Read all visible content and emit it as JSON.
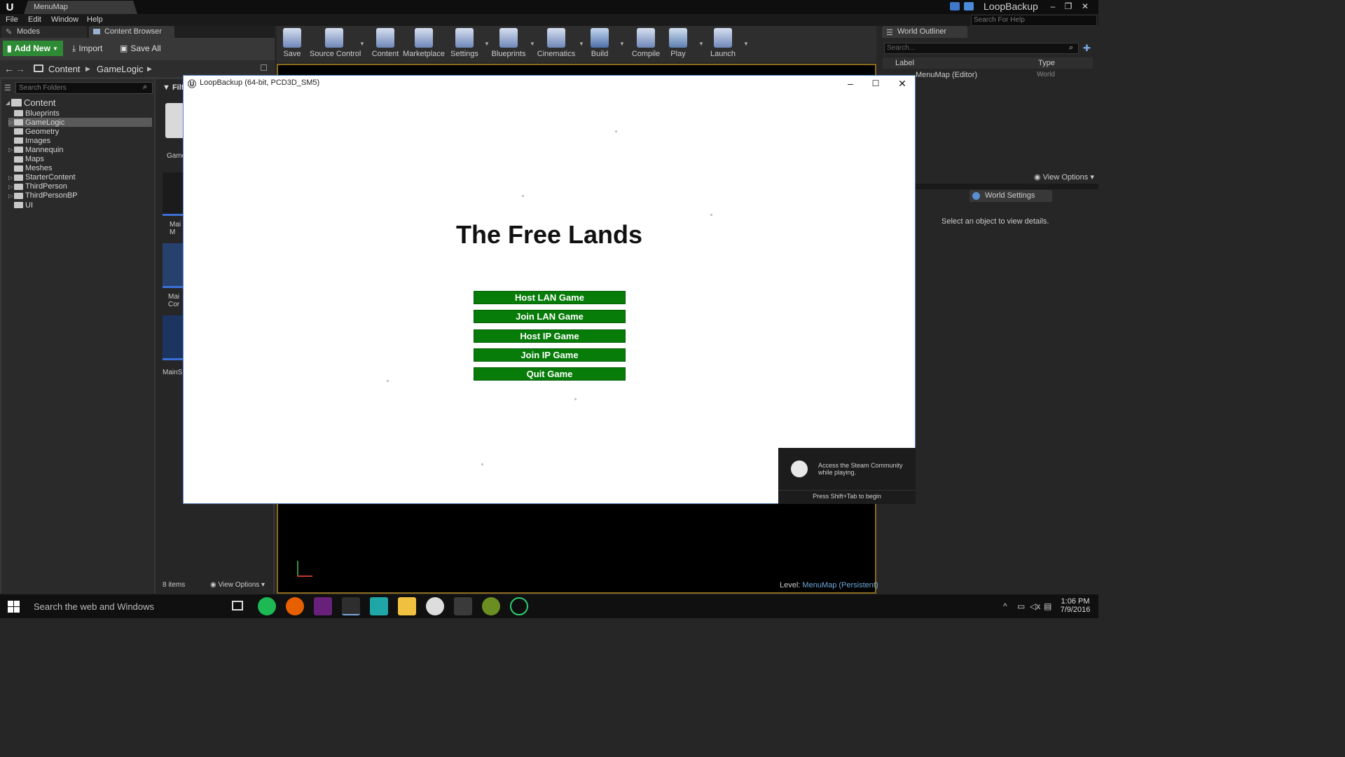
{
  "titlebar": {
    "tab_title": "MenuMap",
    "project_name": "LoopBackup"
  },
  "menubar": {
    "items": [
      "File",
      "Edit",
      "Window",
      "Help"
    ],
    "help_search_placeholder": "Search For Help"
  },
  "left_tabs": {
    "modes": "Modes",
    "content_browser": "Content Browser"
  },
  "content_browser": {
    "add_new": "Add New",
    "import": "Import",
    "save_all": "Save All",
    "path": [
      "Content",
      "GameLogic"
    ],
    "search_folders_placeholder": "Search Folders",
    "filters": "Filte",
    "root": "Content",
    "folders": [
      "Blueprints",
      "GameLogic",
      "Geometry",
      "Images",
      "Mannequin",
      "Maps",
      "Meshes",
      "StarterContent",
      "ThirdPerson",
      "ThirdPersonBP",
      "UI"
    ],
    "assets": [
      "Game",
      "Mai\nM",
      "Mai\nCor",
      "MainS"
    ],
    "item_count": "8 items",
    "view_options": "View Options"
  },
  "toolbar": {
    "buttons": [
      "Save",
      "Source Control",
      "Content",
      "Marketplace",
      "Settings",
      "Blueprints",
      "Cinematics",
      "Build",
      "Compile",
      "Play",
      "Launch"
    ]
  },
  "viewport": {
    "level_label": "Level:",
    "level_name": "MenuMap (Persistent)"
  },
  "game_window": {
    "title": "LoopBackup (64-bit, PCD3D_SM5)",
    "heading": "The Free Lands",
    "buttons": [
      "Host LAN Game",
      "Join LAN Game",
      "Host IP Game",
      "Join IP Game",
      "Quit Game"
    ],
    "steam": {
      "line1": "Access the Steam Community",
      "line2": "while playing.",
      "hint": "Press Shift+Tab to begin"
    }
  },
  "world_outliner": {
    "tab": "World Outliner",
    "search_placeholder": "Search...",
    "col_label": "Label",
    "col_type": "Type",
    "rows": [
      {
        "label": "MenuMap (Editor)",
        "type": "World"
      }
    ],
    "view_options": "View Options"
  },
  "details": {
    "tab_world_settings": "World Settings",
    "empty_text": "Select an object to view details."
  },
  "taskbar": {
    "search_text": "Search the web and Windows",
    "time": "1:06 PM",
    "date": "7/9/2016"
  },
  "colors": {
    "accent_green": "#077c09",
    "editor_bg": "#262626",
    "selection": "#5a5a5a",
    "add_new_green": "#2e8b35"
  }
}
